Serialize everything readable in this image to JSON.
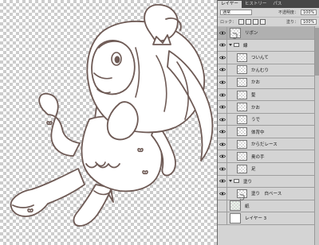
{
  "panel": {
    "tabs": [
      {
        "label": "レイヤー"
      },
      {
        "label": "ヒストリー"
      },
      {
        "label": "パス"
      }
    ],
    "blend_mode": "通常",
    "opacity_label": "不透明度：",
    "opacity_value": "100%",
    "lock_label": "ロック：",
    "fill_label": "塗り：",
    "fill_value": "100%"
  },
  "layers": [
    {
      "name": "リボン",
      "type": "layer",
      "depth": 0,
      "visible": true,
      "active": true,
      "thumb": "sketch"
    },
    {
      "name": "線",
      "type": "group",
      "depth": 0,
      "visible": true,
      "active": false
    },
    {
      "name": "ついんて",
      "type": "layer",
      "depth": 1,
      "visible": true,
      "active": false,
      "thumb": "transparent"
    },
    {
      "name": "かんむり",
      "type": "layer",
      "depth": 1,
      "visible": true,
      "active": false,
      "thumb": "transparent"
    },
    {
      "name": "かお",
      "type": "layer",
      "depth": 1,
      "visible": true,
      "active": false,
      "thumb": "transparent"
    },
    {
      "name": "髪",
      "type": "layer",
      "depth": 1,
      "visible": true,
      "active": false,
      "thumb": "transparent"
    },
    {
      "name": "かお",
      "type": "layer",
      "depth": 1,
      "visible": true,
      "active": false,
      "thumb": "transparent"
    },
    {
      "name": "うで",
      "type": "layer",
      "depth": 1,
      "visible": true,
      "active": false,
      "thumb": "transparent"
    },
    {
      "name": "体背中",
      "type": "layer",
      "depth": 1,
      "visible": true,
      "active": false,
      "thumb": "transparent"
    },
    {
      "name": "からだレース",
      "type": "layer",
      "depth": 1,
      "visible": true,
      "active": false,
      "thumb": "transparent"
    },
    {
      "name": "奥の手",
      "type": "layer",
      "depth": 1,
      "visible": true,
      "active": false,
      "thumb": "transparent"
    },
    {
      "name": "足",
      "type": "layer",
      "depth": 1,
      "visible": true,
      "active": false,
      "thumb": "transparent"
    },
    {
      "name": "塗り",
      "type": "group",
      "depth": 0,
      "visible": true,
      "active": false
    },
    {
      "name": "塗り　白ベース",
      "type": "layer",
      "depth": 1,
      "visible": true,
      "active": false,
      "thumb": "sketch"
    },
    {
      "name": "紙",
      "type": "layer",
      "depth": 0,
      "visible": false,
      "active": false,
      "thumb": "green"
    },
    {
      "name": "レイヤー 3",
      "type": "layer",
      "depth": 0,
      "visible": false,
      "active": false,
      "thumb": "white"
    }
  ],
  "colors": {
    "line_art": "#6e5a55",
    "panel_bg": "#d4d4d4",
    "tab_bar": "#474747",
    "active_layer": "#b0b0b0"
  }
}
